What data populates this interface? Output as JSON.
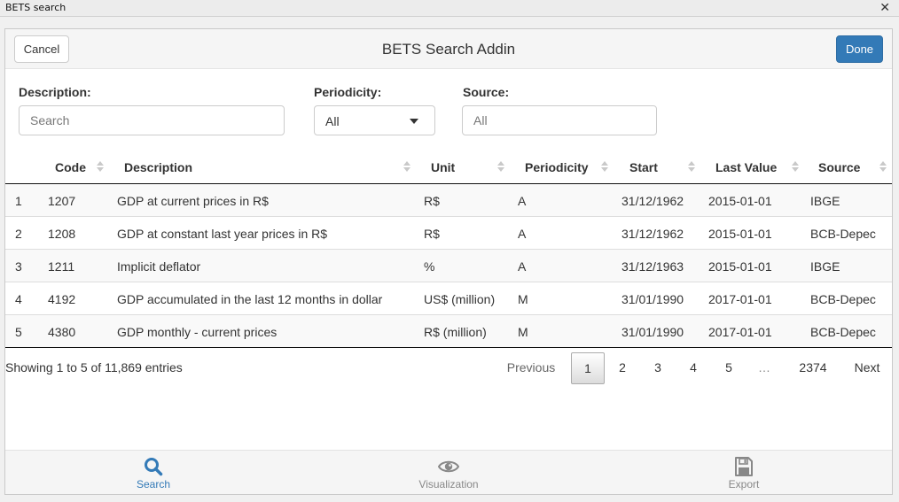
{
  "window": {
    "title": "BETS search"
  },
  "header": {
    "cancel_label": "Cancel",
    "title": "BETS Search Addin",
    "done_label": "Done"
  },
  "filters": {
    "description": {
      "label": "Description:",
      "placeholder": "Search",
      "value": ""
    },
    "periodicity": {
      "label": "Periodicity:",
      "selected": "All"
    },
    "source": {
      "label": "Source:",
      "placeholder": "All",
      "value": ""
    }
  },
  "table": {
    "columns": [
      "Code",
      "Description",
      "Unit",
      "Periodicity",
      "Start",
      "Last Value",
      "Source"
    ],
    "rows": [
      {
        "index": "1",
        "code": "1207",
        "description": "GDP at current prices in R$",
        "unit": "R$",
        "periodicity": "A",
        "start": "31/12/1962",
        "last_value": "2015-01-01",
        "source": "IBGE"
      },
      {
        "index": "2",
        "code": "1208",
        "description": "GDP at constant last year prices in R$",
        "unit": "R$",
        "periodicity": "A",
        "start": "31/12/1962",
        "last_value": "2015-01-01",
        "source": "BCB-Depec"
      },
      {
        "index": "3",
        "code": "1211",
        "description": "Implicit deflator",
        "unit": "%",
        "periodicity": "A",
        "start": "31/12/1963",
        "last_value": "2015-01-01",
        "source": "IBGE"
      },
      {
        "index": "4",
        "code": "4192",
        "description": "GDP accumulated in the last 12 months in dollar",
        "unit": "US$ (million)",
        "periodicity": "M",
        "start": "31/01/1990",
        "last_value": "2017-01-01",
        "source": "BCB-Depec"
      },
      {
        "index": "5",
        "code": "4380",
        "description": "GDP monthly - current prices",
        "unit": "R$ (million)",
        "periodicity": "M",
        "start": "31/01/1990",
        "last_value": "2017-01-01",
        "source": "BCB-Depec"
      }
    ]
  },
  "pagination": {
    "info": "Showing 1 to 5 of 11,869 entries",
    "previous": "Previous",
    "pages": [
      "1",
      "2",
      "3",
      "4",
      "5",
      "…",
      "2374"
    ],
    "current": "1",
    "next": "Next"
  },
  "tabs": [
    {
      "label": "Search",
      "icon": "search-icon",
      "active": true
    },
    {
      "label": "Visualization",
      "icon": "eye-icon",
      "active": false
    },
    {
      "label": "Export",
      "icon": "save-icon",
      "active": false
    }
  ],
  "colors": {
    "primary": "#337ab7",
    "muted": "#888888"
  }
}
